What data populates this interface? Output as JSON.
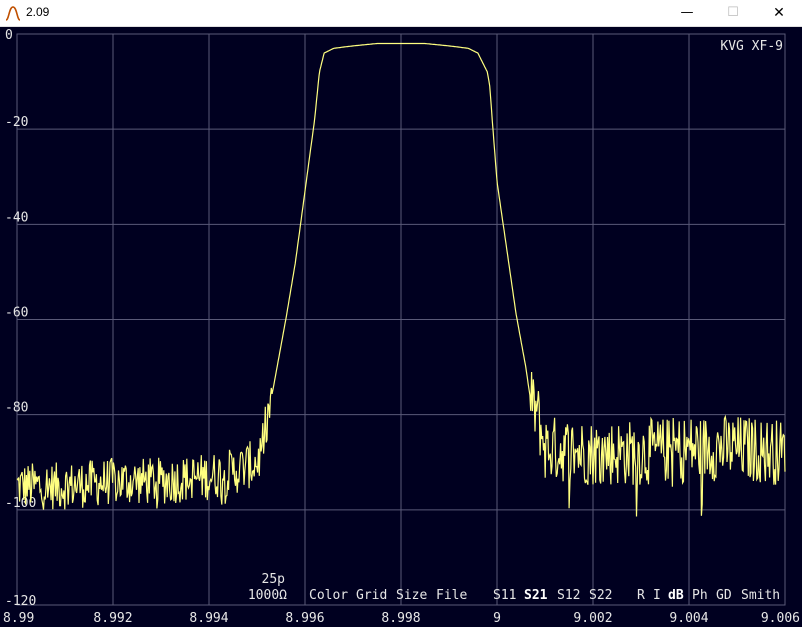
{
  "window": {
    "title": "2.09",
    "icon": "filter-response-icon",
    "minimize": "—",
    "maximize": "☐",
    "close": "✕"
  },
  "plot": {
    "device_label": "KVG XF-9",
    "param_capacitance": "25p",
    "param_impedance": "1000Ω",
    "colors": {
      "background": "#000020",
      "grid": "#5a5a78",
      "trace": "#ffff80",
      "text": "#e6e6e6"
    }
  },
  "menu": {
    "items": [
      "Color",
      "Grid",
      "Size",
      "File"
    ],
    "sparams": [
      "S11",
      "S21",
      "S12",
      "S22"
    ],
    "selected_sparam": "S21",
    "views": [
      "R",
      "I",
      "dB",
      "Ph",
      "GD",
      "Smith"
    ],
    "selected_view": "dB"
  },
  "chart_data": {
    "type": "line",
    "title": "",
    "xlabel": "",
    "ylabel": "",
    "xlim": [
      8.99,
      9.006
    ],
    "ylim": [
      -120,
      0
    ],
    "grid": true,
    "x_ticks": [
      "8.99",
      "8.992",
      "8.994",
      "8.996",
      "8.998",
      "9",
      "9.002",
      "9.004",
      "9.006"
    ],
    "y_ticks": [
      "0",
      "-20",
      "-40",
      "-60",
      "-80",
      "-100",
      "-120"
    ],
    "series": [
      {
        "x": [
          8.99,
          8.991,
          8.992,
          8.993,
          8.994,
          8.9945,
          8.995,
          8.99505,
          8.9952,
          8.9954,
          8.9956,
          8.9958,
          8.996,
          8.9962,
          8.9963,
          8.9964,
          8.9966,
          8.997,
          8.9975,
          8.998,
          8.9985,
          8.999,
          8.9994,
          8.9996,
          8.9998,
          8.99985,
          8.9999,
          9.0,
          9.0002,
          9.0004,
          9.0006,
          9.0007,
          9.0008,
          9.00082,
          9.001,
          9.002,
          9.003,
          9.004,
          9.005,
          9.006
        ],
        "y": [
          -95,
          -95,
          -94,
          -94,
          -93,
          -92,
          -90,
          -89,
          -82,
          -71,
          -60,
          -48,
          -33,
          -18,
          -8,
          -4,
          -3,
          -2.5,
          -2,
          -2,
          -2,
          -2.5,
          -3,
          -4,
          -8,
          -11,
          -18,
          -31,
          -45,
          -59,
          -70,
          -77,
          -79,
          -79,
          -87,
          -88,
          -88,
          -87,
          -87,
          -88
        ]
      }
    ]
  }
}
